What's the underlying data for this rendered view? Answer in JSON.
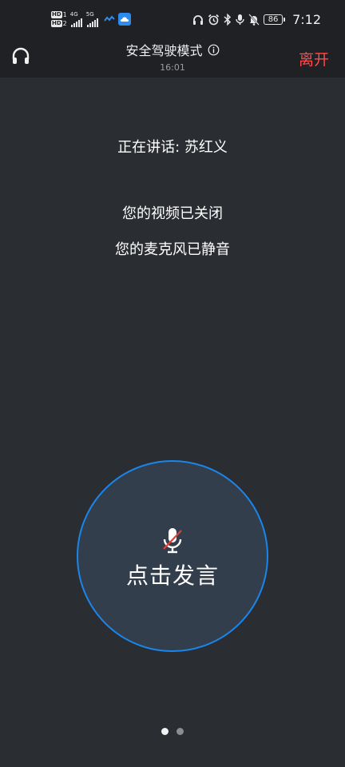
{
  "status_bar": {
    "hd1_label": "HD",
    "hd1_num": "1",
    "hd2_label": "HD",
    "hd2_num": "2",
    "net1": "4G",
    "net2": "5G",
    "battery": "86",
    "time": "7:12",
    "icons": [
      "headphones-icon",
      "alarm-icon",
      "bluetooth-icon",
      "mic-icon",
      "bell-off-icon"
    ]
  },
  "header": {
    "title": "安全驾驶模式",
    "subtitle": "16:01",
    "leave_label": "离开",
    "leave_color": "#ff4a4a"
  },
  "main": {
    "speaking_text": "正在讲话: 苏红义",
    "video_status": "您的视频已关闭",
    "mic_status": "您的麦克风已静音"
  },
  "speak_button": {
    "label": "点击发言",
    "ring_color": "#1a86ec",
    "fill_color": "#323e4c",
    "mic_icon": "mic-muted-icon"
  },
  "pager": {
    "count": 2,
    "active_index": 0
  }
}
